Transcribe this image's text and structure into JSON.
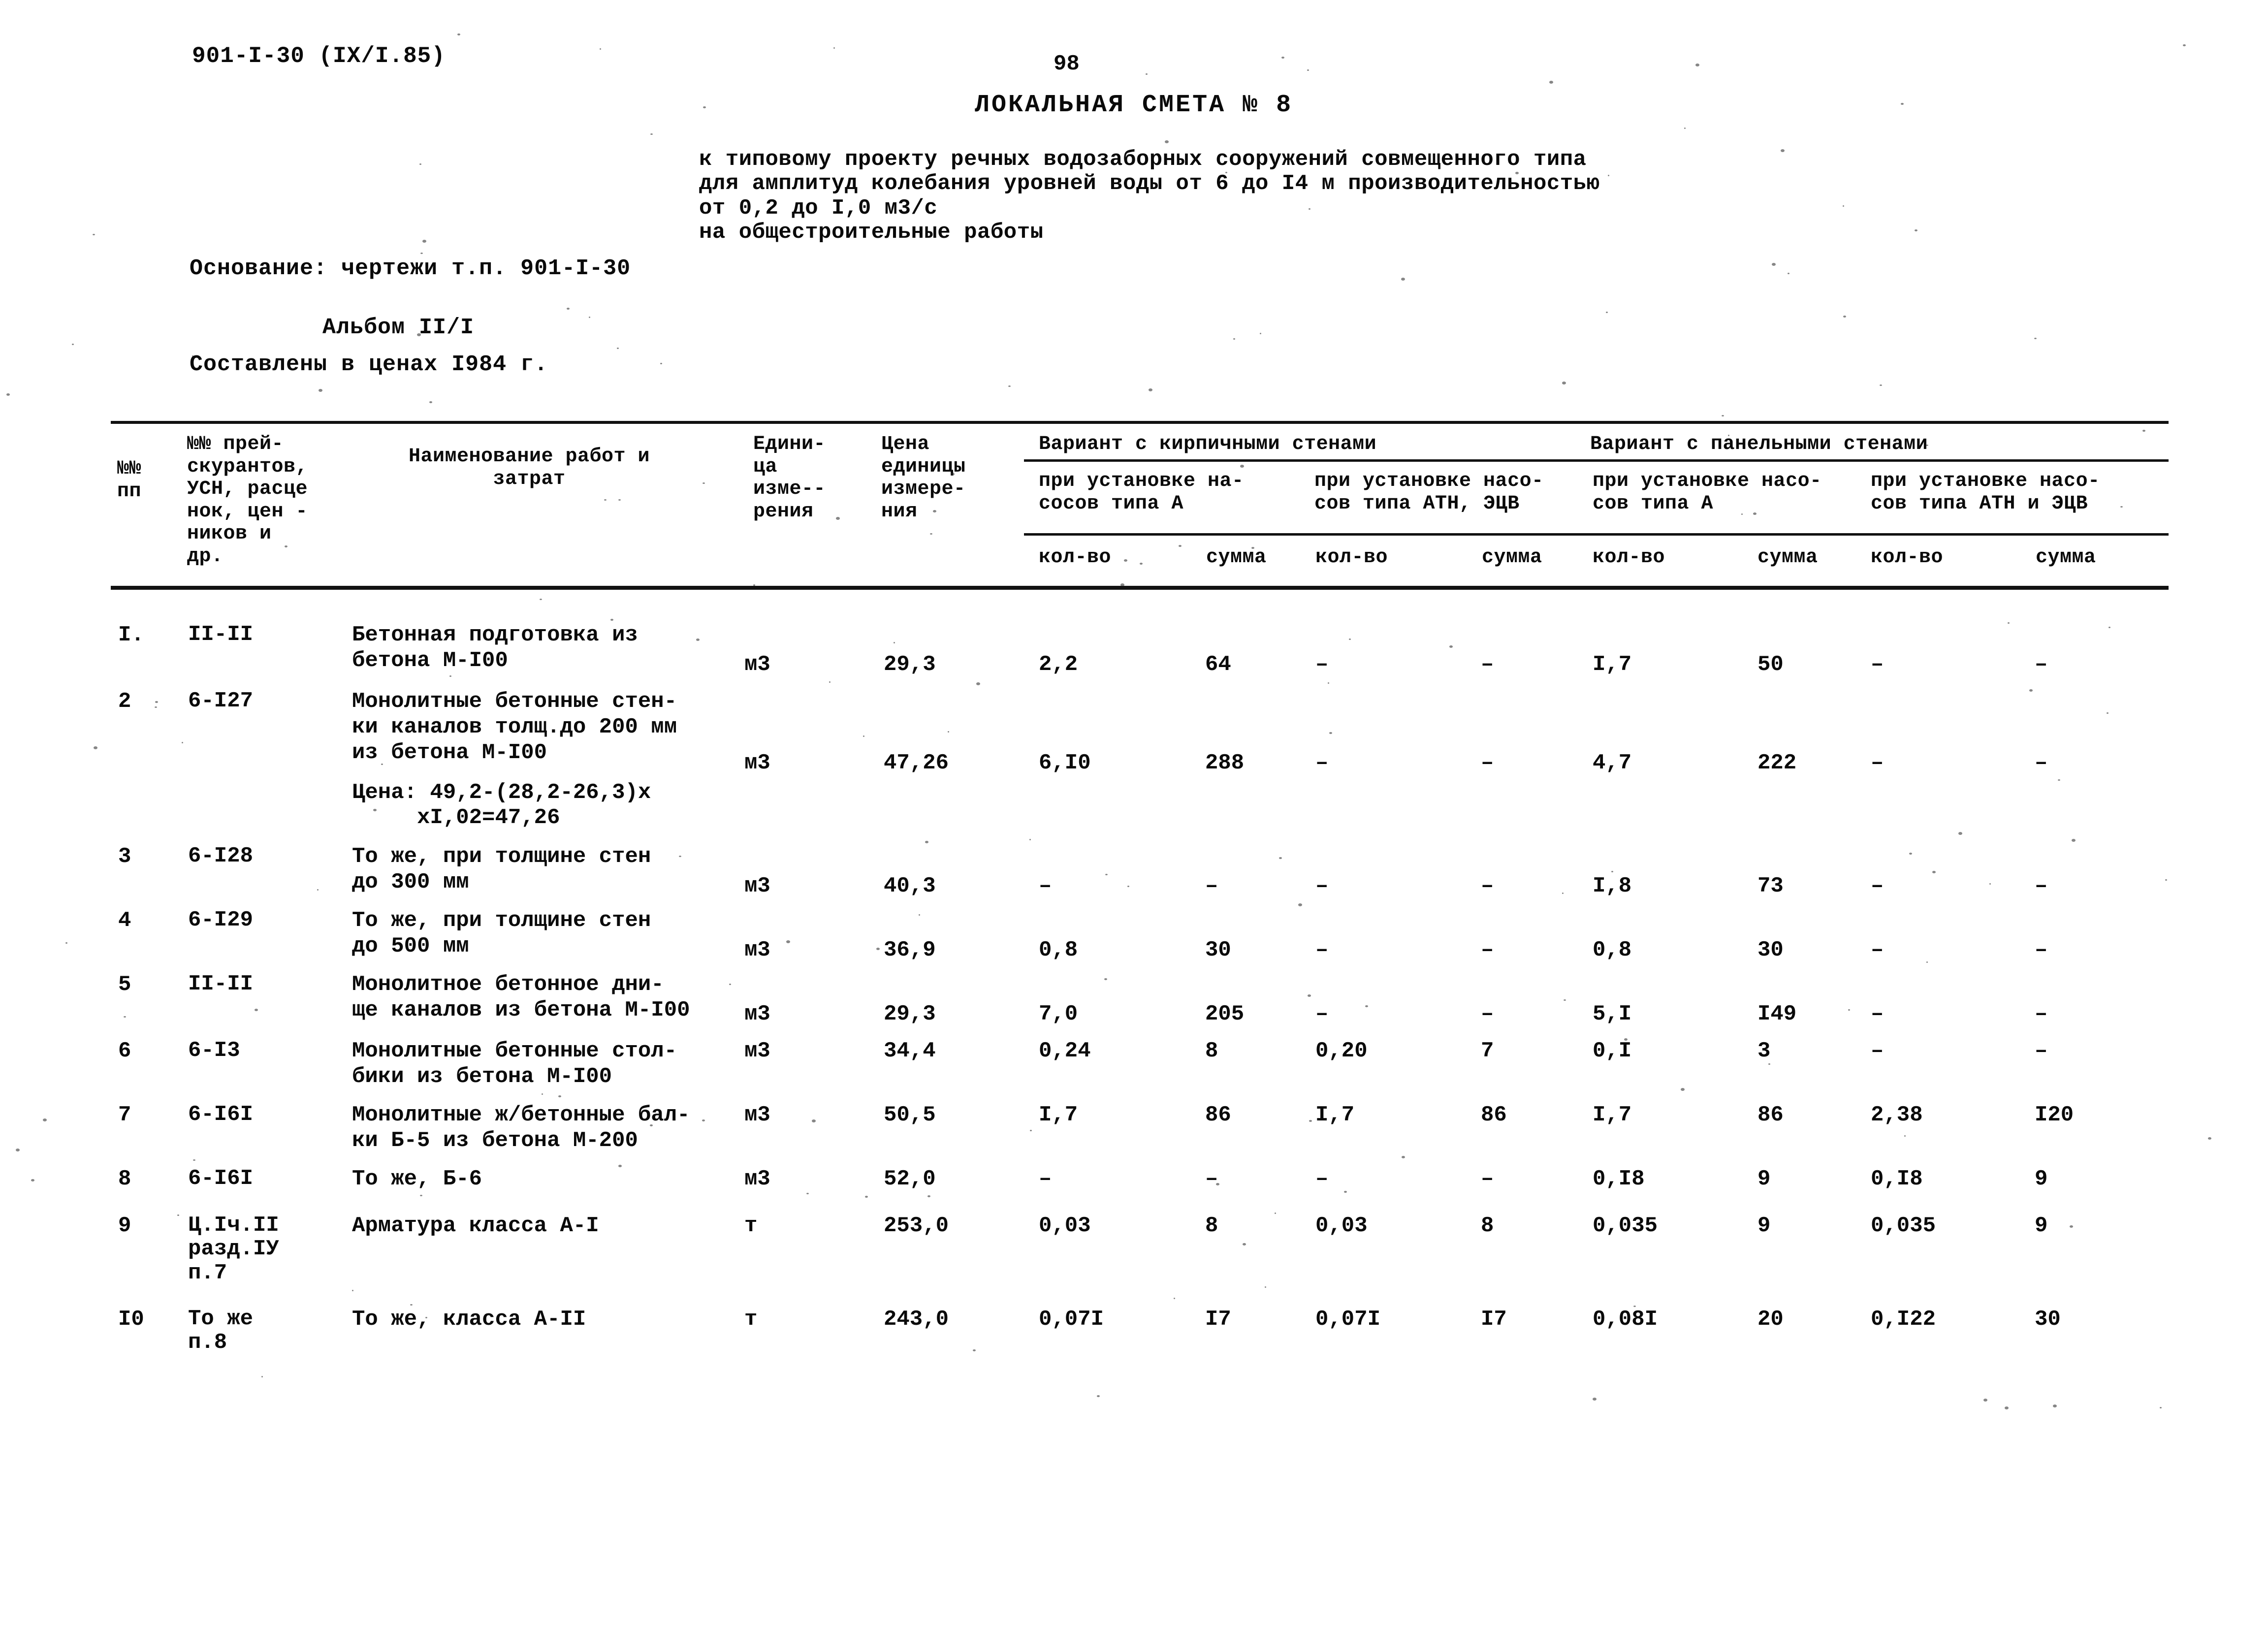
{
  "header": {
    "doc_code": "901-I-30 (IX/I.85)",
    "page_number": "98"
  },
  "title": {
    "main": "ЛОКАЛЬНАЯ СМЕТА № 8",
    "subtitle_lines": [
      "к типовому проекту речных водозаборных сооружений совмещенного типа",
      "для амплитуд колебания уровней воды от 6 до I4 м производительностью",
      "от 0,2 до I,0 м3/с",
      "на общестроительные работы"
    ]
  },
  "basis": {
    "basis_line": "Основание: чертежи т.п. 901-I-30",
    "album_line": "Альбом II/I",
    "prices_line": "Составлены в ценах I984 г."
  },
  "table": {
    "headers": {
      "num": "№№\nпп",
      "codes": "№№ прей-\nскурантов,\nУСН, расце\nнок, цен -\nников и\nдр.",
      "name": "Наименование работ и\nзатрат",
      "unit": "Едини-\nца\nизме--\nрения",
      "price": "Цена\nединицы\nизмере-\nния",
      "variant_brick": "Вариант с кирпичными стенами",
      "variant_panel": "Вариант с панельными стенами",
      "sub": [
        "при установке на-\nсосов типа А",
        "при установке насо-\nсов типа АТН, ЭЦВ",
        "при установке насо-\nсов типа А",
        "при установке насо-\nсов типа АТН и ЭЦВ"
      ],
      "leaf": [
        "кол-во",
        "сумма",
        "кол-во",
        "сумма",
        "кол-во",
        "сумма",
        "кол-во",
        "сумма"
      ]
    },
    "rows": [
      {
        "num": "I.",
        "code": "II-II",
        "name": "Бетонная подготовка из\nбетона М-I00",
        "unit": "м3",
        "price": "29,3",
        "values": [
          "2,2",
          "64",
          "–",
          "–",
          "I,7",
          "50",
          "–",
          "–"
        ]
      },
      {
        "num": "2",
        "code": "6-I27",
        "name": "Монолитные бетонные стен-\nки каналов толщ.до 200 мм\nиз бетона М-I00",
        "unit": "м3",
        "price": "47,26",
        "values": [
          "6,I0",
          "288",
          "–",
          "–",
          "4,7",
          "222",
          "–",
          "–"
        ],
        "note": "Цена: 49,2-(28,2-26,3)х\n     хI,02=47,26"
      },
      {
        "num": "3",
        "code": "6-I28",
        "name": "То же, при толщине стен\nдо 300 мм",
        "unit": "м3",
        "price": "40,3",
        "values": [
          "–",
          "–",
          "–",
          "–",
          "I,8",
          "73",
          "–",
          "–"
        ]
      },
      {
        "num": "4",
        "code": "6-I29",
        "name": "То же, при толщине стен\nдо 500 мм",
        "unit": "м3",
        "price": "36,9",
        "values": [
          "0,8",
          "30",
          "–",
          "–",
          "0,8",
          "30",
          "–",
          "–"
        ]
      },
      {
        "num": "5",
        "code": "II-II",
        "name": "Монолитное бетонное дни-\nще каналов из бетона М-I00",
        "unit": "м3",
        "price": "29,3",
        "values": [
          "7,0",
          "205",
          "–",
          "–",
          "5,I",
          "I49",
          "–",
          "–"
        ]
      },
      {
        "num": "6",
        "code": "6-I3",
        "name": "Монолитные бетонные стол-\nбики из бетона М-I00",
        "unit": "м3",
        "price": "34,4",
        "values": [
          "0,24",
          "8",
          "0,20",
          "7",
          "0,I",
          "3",
          "–",
          "–"
        ]
      },
      {
        "num": "7",
        "code": "6-I6I",
        "name": "Монолитные ж/бетонные бал-\nки Б-5 из бетона М-200",
        "unit": "м3",
        "price": "50,5",
        "values": [
          "I,7",
          "86",
          "I,7",
          "86",
          "I,7",
          "86",
          "2,38",
          "I20"
        ]
      },
      {
        "num": "8",
        "code": "6-I6I",
        "name": "То же, Б-6",
        "unit": "м3",
        "price": "52,0",
        "values": [
          "–",
          "–",
          "–",
          "–",
          "0,I8",
          "9",
          "0,I8",
          "9"
        ]
      },
      {
        "num": "9",
        "code": "Ц.Iч.II\nразд.IУ\nп.7",
        "name": "Арматура класса А-I",
        "unit": "т",
        "price": "253,0",
        "values": [
          "0,03",
          "8",
          "0,03",
          "8",
          "0,035",
          "9",
          "0,035",
          "9"
        ]
      },
      {
        "num": "I0",
        "code": "То же\nп.8",
        "name": "То же, класса А-II",
        "unit": "т",
        "price": "243,0",
        "values": [
          "0,07I",
          "I7",
          "0,07I",
          "I7",
          "0,08I",
          "20",
          "0,I22",
          "30"
        ]
      }
    ]
  }
}
